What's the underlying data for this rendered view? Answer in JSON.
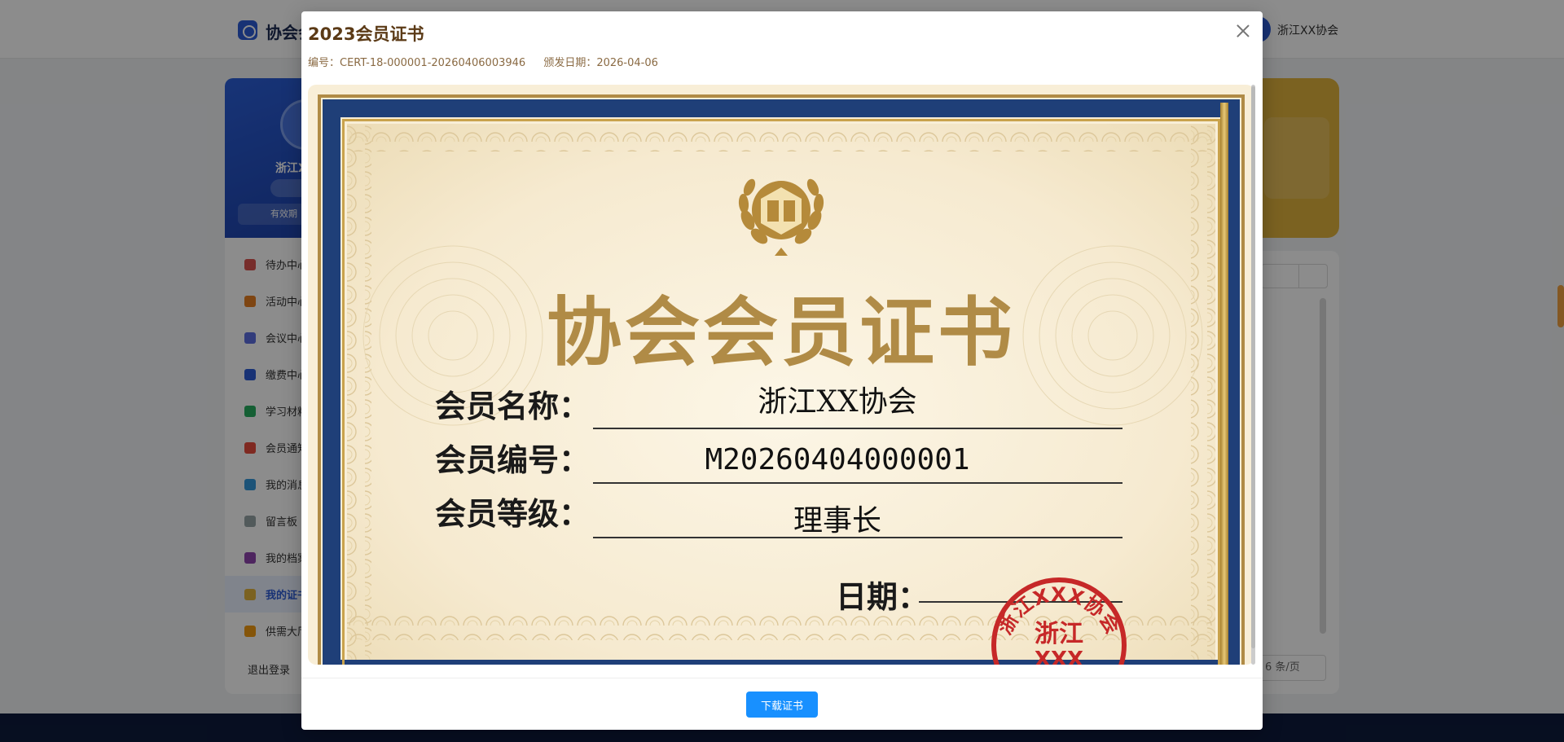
{
  "app": {
    "title": "协会会员服务平台",
    "user_name": "浙江XX协会"
  },
  "sidebar": {
    "org_name": "浙江XX协会",
    "valid_label": "有效期",
    "items": [
      {
        "label": "待办中心",
        "color": "#d9534f"
      },
      {
        "label": "活动中心",
        "color": "#e67e22"
      },
      {
        "label": "会议中心",
        "color": "#5b6ee1"
      },
      {
        "label": "缴费中心",
        "color": "#2c5bd6"
      },
      {
        "label": "学习材料",
        "color": "#27ae60"
      },
      {
        "label": "会员通知",
        "color": "#e74c3c"
      },
      {
        "label": "我的消息",
        "color": "#3498db"
      },
      {
        "label": "留言板",
        "color": "#95a5a6"
      },
      {
        "label": "我的档案",
        "color": "#8e44ad"
      },
      {
        "label": "我的证书",
        "color": "#e1b33d",
        "active": true
      },
      {
        "label": "供需大厅",
        "color": "#f39c12"
      }
    ],
    "logout": "退出登录"
  },
  "pager": {
    "page_size": "6 条/页"
  },
  "modal": {
    "title": "2023会员证书",
    "cert_no_label": "编号：",
    "cert_no": "CERT-18-000001-20260406003946",
    "issue_date_label": "颁发日期：",
    "issue_date": "2026-04-06",
    "download_label": "下载证书"
  },
  "certificate": {
    "heading": "协会会员证书",
    "name_label": "会员名称：",
    "name_value": "浙江XX协会",
    "number_label": "会员编号：",
    "number_value": "M20260404000001",
    "level_label": "会员等级：",
    "level_value": "理事长",
    "date_label": "日期：",
    "seal_top": "浙江XXX协会",
    "seal_mid": "浙江",
    "seal_bottom": "XXX"
  },
  "colors": {
    "accent": "#1890ff",
    "gold": "#b08b46",
    "navy": "#1f3f78",
    "seal": "#c62828"
  }
}
